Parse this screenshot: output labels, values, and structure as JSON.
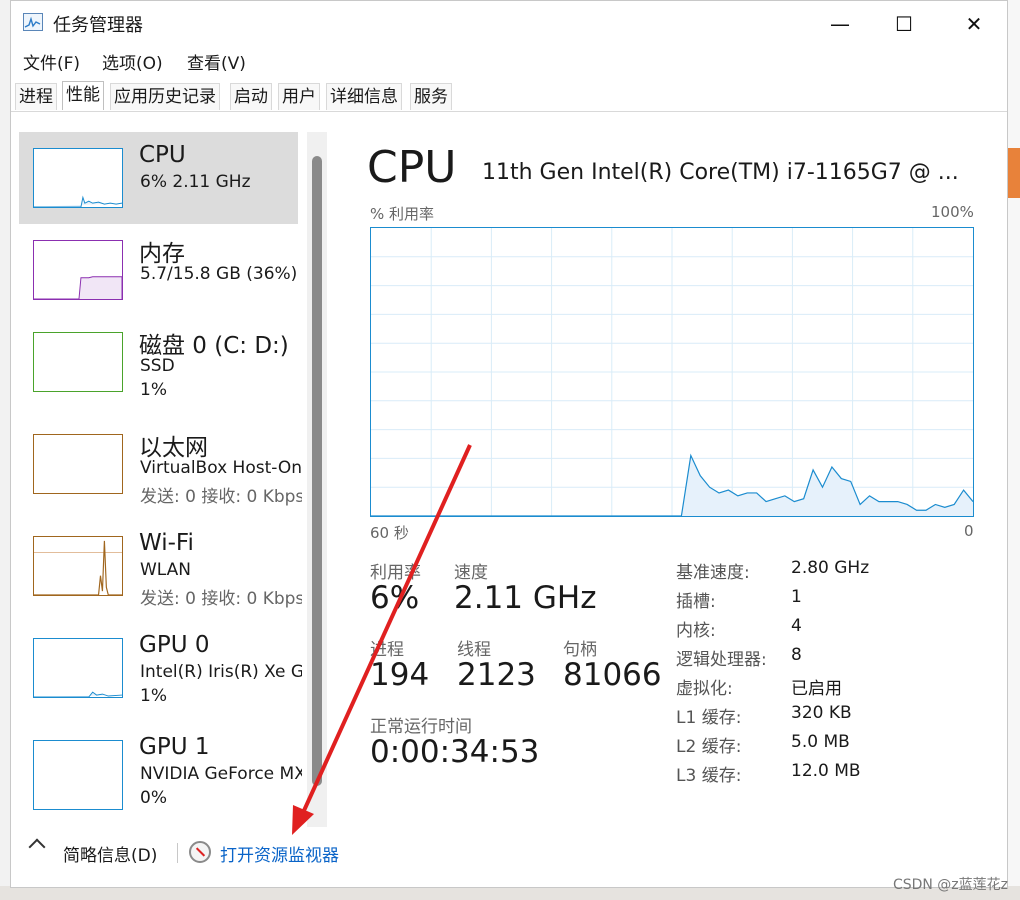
{
  "window": {
    "title": "任务管理器",
    "minimize": "—",
    "maximize": "☐",
    "close": "✕"
  },
  "menu": [
    "文件(F)",
    "选项(O)",
    "查看(V)"
  ],
  "tabs": [
    "进程",
    "性能",
    "应用历史记录",
    "启动",
    "用户",
    "详细信息",
    "服务"
  ],
  "active_tab": "性能",
  "sidebar": [
    {
      "name": "CPU",
      "line1": "6%  2.11 GHz",
      "line2": "",
      "color": "#1b8ccf"
    },
    {
      "name": "内存",
      "line1": "5.7/15.8 GB (36%)",
      "line2": "",
      "color": "#8b2fb0"
    },
    {
      "name": "磁盘 0 (C: D:)",
      "line1": "SSD",
      "line2": "1%",
      "color": "#4aa32b"
    },
    {
      "name": "以太网",
      "line1": "VirtualBox Host-Only",
      "line2": "发送: 0 接收: 0 Kbps",
      "color": "#a0661e"
    },
    {
      "name": "Wi-Fi",
      "line1": "WLAN",
      "line2": "发送: 0 接收: 0 Kbps",
      "color": "#a0661e"
    },
    {
      "name": "GPU 0",
      "line1": "Intel(R) Iris(R) Xe Graphics",
      "line2": "1%",
      "color": "#1b8ccf"
    },
    {
      "name": "GPU 1",
      "line1": "NVIDIA GeForce MX",
      "line2": "0%",
      "color": "#1b8ccf"
    }
  ],
  "detail": {
    "title": "CPU",
    "model": "11th Gen Intel(R) Core(TM) i7-1165G7 @ ...",
    "axis_label": "% 利用率",
    "axis_max": "100%",
    "axis_time": "60 秒",
    "axis_min": "0",
    "utilization_label": "利用率",
    "utilization": "6%",
    "speed_label": "速度",
    "speed": "2.11 GHz",
    "processes_label": "进程",
    "processes": "194",
    "threads_label": "线程",
    "threads": "2123",
    "handles_label": "句柄",
    "handles": "81066",
    "uptime_label": "正常运行时间",
    "uptime": "0:00:34:53",
    "specs": [
      {
        "label": "基准速度:",
        "value": "2.80 GHz"
      },
      {
        "label": "插槽:",
        "value": "1"
      },
      {
        "label": "内核:",
        "value": "4"
      },
      {
        "label": "逻辑处理器:",
        "value": "8"
      },
      {
        "label": "虚拟化:",
        "value": "已启用"
      },
      {
        "label": "L1 缓存:",
        "value": "320 KB"
      },
      {
        "label": "L2 缓存:",
        "value": "5.0 MB"
      },
      {
        "label": "L3 缓存:",
        "value": "12.0 MB"
      }
    ],
    "history_percent": [
      0,
      0,
      0,
      0,
      0,
      0,
      0,
      0,
      0,
      0,
      0,
      0,
      0,
      0,
      0,
      0,
      0,
      0,
      0,
      0,
      0,
      0,
      0,
      0,
      0,
      0,
      0,
      0,
      0,
      0,
      0,
      0,
      0,
      0,
      21,
      14,
      10,
      8,
      9,
      7,
      8,
      8,
      5,
      6,
      7,
      5,
      6,
      16,
      10,
      17,
      13,
      12,
      4,
      7,
      5,
      5,
      5,
      4,
      2,
      2,
      4,
      3,
      4,
      9,
      5
    ]
  },
  "footer": {
    "brief": "简略信息(D)",
    "open_monitor": "打开资源监视器"
  },
  "watermark": "CSDN @z蓝莲花z"
}
